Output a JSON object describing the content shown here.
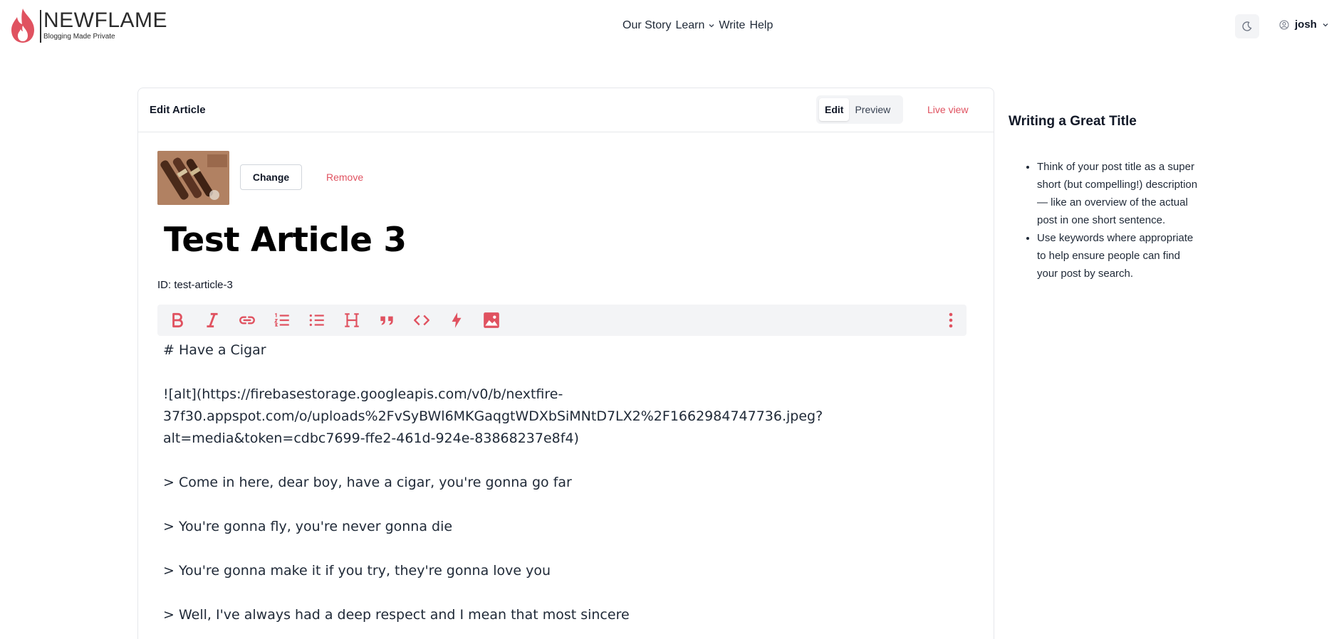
{
  "brand": {
    "name": "NEWFLAME",
    "tagline": "Blogging Made Private",
    "accent": "#e05260"
  },
  "nav": {
    "items": [
      {
        "label": "Our Story"
      },
      {
        "label": "Learn"
      },
      {
        "label": "Write"
      },
      {
        "label": "Help"
      }
    ]
  },
  "user": {
    "name": "josh"
  },
  "card": {
    "title": "Edit Article",
    "modes": {
      "edit": "Edit",
      "preview": "Preview",
      "active": "Edit"
    },
    "live_view": "Live view"
  },
  "cover": {
    "change_label": "Change",
    "remove_label": "Remove"
  },
  "article": {
    "title": "Test Article 3",
    "id_text": "ID: test-article-3"
  },
  "toolbar": {
    "tools": [
      "bold-icon",
      "italic-icon",
      "link-icon",
      "ordered-list-icon",
      "unordered-list-icon",
      "heading-icon",
      "quote-icon",
      "code-icon",
      "lightning-icon",
      "image-icon"
    ],
    "more": "more-vertical-icon"
  },
  "editor": {
    "lines": {
      "l1": "# Have a Cigar",
      "l2": "![alt](https://firebasestorage.googleapis.com/v0/b/nextfire-",
      "l3": "37f30.appspot.com/o/uploads%2FvSyBWl6MKGaqgtWDXbSiMNtD7LX2%2F1662984747736.jpeg?",
      "l4": "alt=media&token=cdbc7699-ffe2-461d-924e-83868237e8f4)",
      "l5": "> Come in here, dear boy, have a cigar, you're gonna go far",
      "l6": "> You're gonna fly, you're never gonna die",
      "l7": "> You're gonna make it if you try, they're gonna love you",
      "l8": "> Well, I've always had a deep respect and I mean that most sincere"
    }
  },
  "tips": {
    "title": "Writing a Great Title",
    "items": [
      "Think of your post title as a super short (but compelling!) description — like an overview of the actual post in one short sentence.",
      "Use keywords where appropriate to help ensure people can find your post by search."
    ]
  }
}
